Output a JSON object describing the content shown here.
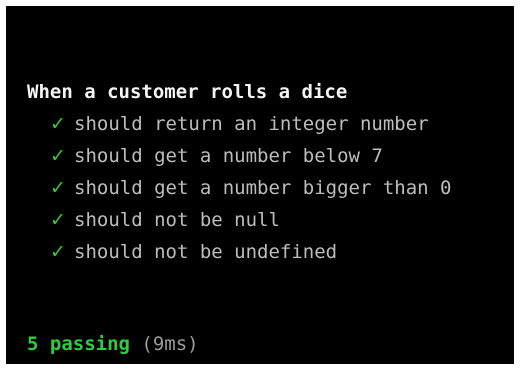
{
  "suite": {
    "title": "When a customer rolls a dice"
  },
  "tests": [
    {
      "status_icon": "check-icon",
      "glyph": "✓",
      "label": "should return an integer number"
    },
    {
      "status_icon": "check-icon",
      "glyph": "✓",
      "label": "should get a number below 7"
    },
    {
      "status_icon": "check-icon",
      "glyph": "✓",
      "label": "should get a number bigger than 0"
    },
    {
      "status_icon": "check-icon",
      "glyph": "✓",
      "label": "should not be null"
    },
    {
      "status_icon": "check-icon",
      "glyph": "✓",
      "label": "should not be undefined"
    }
  ],
  "summary": {
    "passing": "5 passing",
    "duration": "(9ms)"
  },
  "colors": {
    "background": "#000000",
    "pass_green": "#2ecc40",
    "title_text": "#f5f5f5",
    "test_text": "#bdbdbd",
    "duration_text": "#9b9b9b"
  }
}
